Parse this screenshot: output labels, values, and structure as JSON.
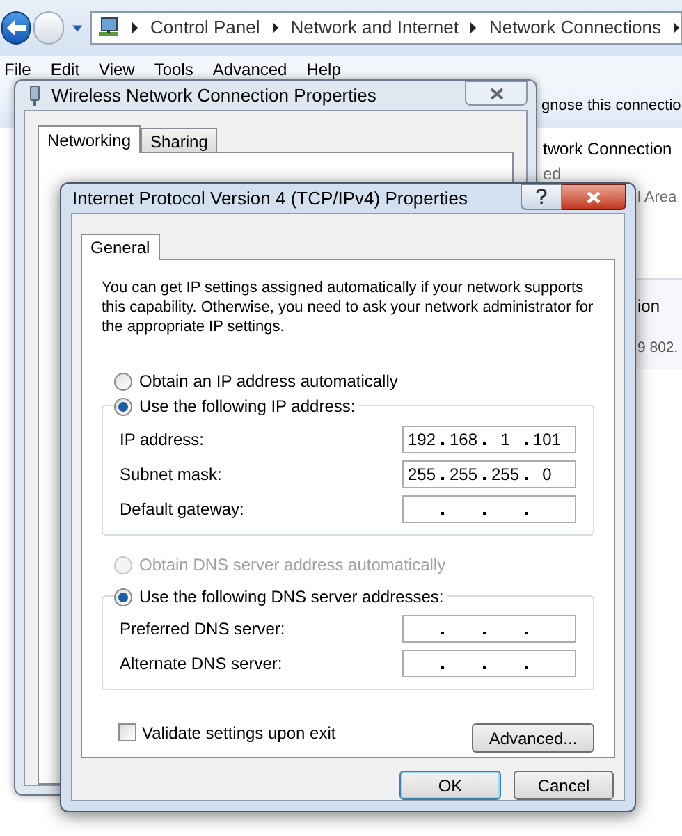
{
  "explorer": {
    "path": [
      "Control Panel",
      "Network and Internet",
      "Network Connections"
    ],
    "menu": [
      "File",
      "Edit",
      "View",
      "Tools",
      "Advanced",
      "Help"
    ],
    "toolbar_text": "gnose this connectio",
    "item_title": "twork Connection",
    "item_lines": [
      "ed",
      "l Area"
    ],
    "details_heading": "ion",
    "details_text": "9 802."
  },
  "wireless_dialog": {
    "title": "Wireless Network Connection Properties",
    "tabs": [
      {
        "label": "Networking",
        "selected": true
      },
      {
        "label": "Sharing",
        "selected": false
      }
    ]
  },
  "tcp_dialog": {
    "title": "Internet Protocol Version 4 (TCP/IPv4) Properties",
    "tabs": [
      {
        "label": "General",
        "selected": true
      }
    ],
    "intro": "You can get IP settings assigned automatically if your network supports this capability. Otherwise, you need to ask your network administrator for the appropriate IP settings.",
    "ip_options": [
      {
        "label": "Obtain an IP address automatically",
        "selected": false,
        "disabled": false
      },
      {
        "label": "Use the following IP address:",
        "selected": true,
        "disabled": false
      }
    ],
    "ip_fields": [
      {
        "label": "IP address:",
        "octets": [
          "192",
          "168",
          "1",
          "101"
        ]
      },
      {
        "label": "Subnet mask:",
        "octets": [
          "255",
          "255",
          "255",
          "0"
        ]
      },
      {
        "label": "Default gateway:"
      }
    ],
    "dns_options": [
      {
        "label": "Obtain DNS server address automatically",
        "selected": false,
        "disabled": true
      },
      {
        "label": "Use the following DNS server addresses:",
        "selected": true,
        "disabled": false
      }
    ],
    "dns_fields": [
      {
        "label": "Preferred DNS server:"
      },
      {
        "label": "Alternate DNS server:"
      }
    ],
    "validate": {
      "label": "Validate settings upon exit",
      "checked": false
    },
    "advanced_button": "Advanced...",
    "ok_button": "OK",
    "cancel_button": "Cancel"
  }
}
